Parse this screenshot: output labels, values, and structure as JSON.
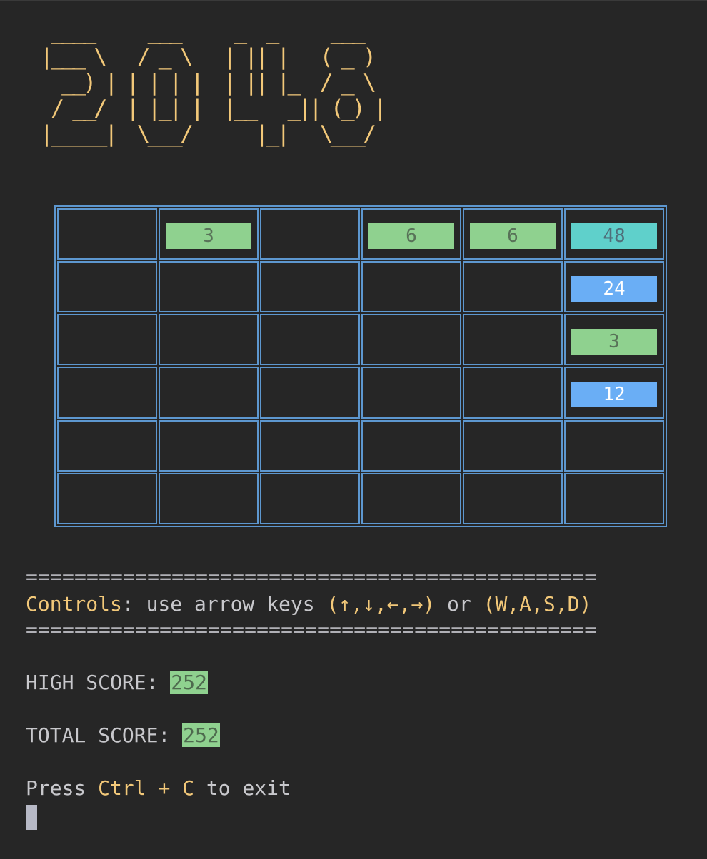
{
  "title_ascii": " ____     ___     _  _     ___ \n|___ \\   / _ \\   | || |   ( _ )\n  __) | | | | |  | || |_  / _ \\\n / __/  | |_| |  |__   _|| (_) |\n|_____|  \\___/      |_|   \\___/",
  "board": {
    "rows": [
      [
        null,
        3,
        null,
        6,
        6,
        48
      ],
      [
        null,
        null,
        null,
        null,
        null,
        24
      ],
      [
        null,
        null,
        null,
        null,
        null,
        3
      ],
      [
        null,
        null,
        null,
        null,
        null,
        12
      ],
      [
        null,
        null,
        null,
        null,
        null,
        null
      ],
      [
        null,
        null,
        null,
        null,
        null,
        null
      ]
    ]
  },
  "tile_colors": {
    "3": {
      "bg": "#8fd18f",
      "fg": "#587258"
    },
    "6": {
      "bg": "#8fd18f",
      "fg": "#587258"
    },
    "12": {
      "bg": "#6aaef5",
      "fg": "#ffffff"
    },
    "24": {
      "bg": "#6aaef5",
      "fg": "#ffffff"
    },
    "48": {
      "bg": "#5fd0cb",
      "fg": "#4f6f7a"
    }
  },
  "separator": "===============================================",
  "controls": {
    "label": "Controls",
    "colon": ":",
    "text": " use arrow keys ",
    "arrows": "(↑,↓,←,→)",
    "or": " or ",
    "wasd": "(W,A,S,D)"
  },
  "high_score": {
    "label": "HIGH SCORE: ",
    "value": "252"
  },
  "total_score": {
    "label": "TOTAL SCORE: ",
    "value": "252"
  },
  "exit_hint": {
    "press": "Press ",
    "keys": "Ctrl + C",
    "rest": " to exit"
  }
}
